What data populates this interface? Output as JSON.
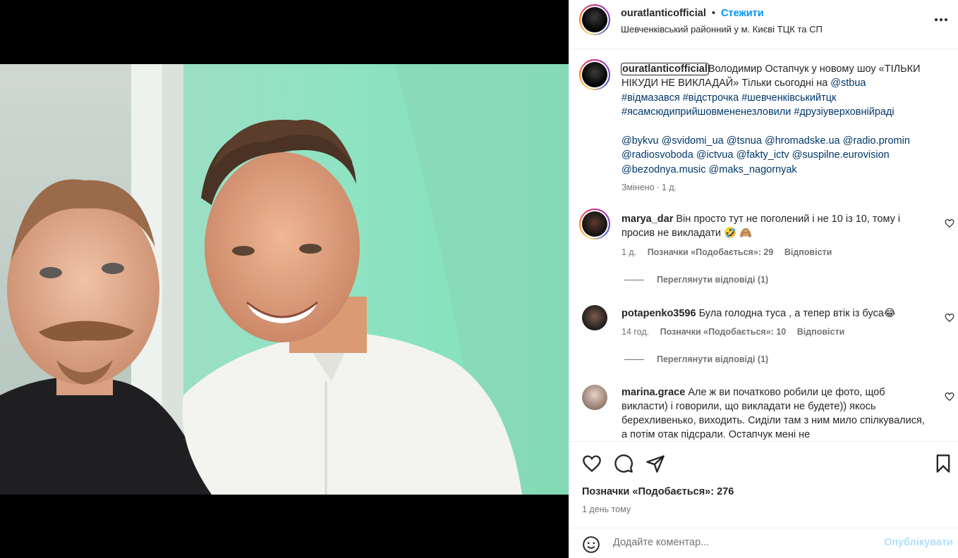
{
  "post": {
    "username": "ouratlanticofficial",
    "dot": "•",
    "follow_label": "Стежити",
    "location": "Шевченківський районний у м. Києві ТЦК та СП",
    "more_icon": "more-horizontal-icon"
  },
  "caption": {
    "username": "ouratlanticofficial",
    "text_lead": "Володимир Остапчук у новому шоу «ТІЛЬКИ НІКУДИ НЕ ВИКЛАДАЙ» Тільки сьогодні на ",
    "stb": "@stbua",
    "hashtags": [
      "#відмазався",
      "#відстрочка",
      "#шевченківськийтцк",
      "#ясамсюдиприйшовмененезловили",
      "#друзіуверховнійраді"
    ],
    "mentions": [
      "@bykvu",
      "@svidomi_ua",
      "@tsnua",
      "@hromadske.ua",
      "@radio.promin",
      "@radiosvoboda",
      "@ictvua",
      "@fakty_ictv",
      "@suspilne.eurovision",
      "@bezodnya.music",
      "@maks_nagornyak"
    ],
    "edited": "Змінено",
    "dot": "·",
    "time": "1 д."
  },
  "comments": [
    {
      "username": "marya_dar",
      "text": "Він просто тут не поголений і не 10 із 10, тому і просив не викладати 🤣 🙈",
      "time": "1 д.",
      "likes": "Позначки «Подобається»: 29",
      "reply": "Відповісти",
      "view_replies": "Переглянути відповіді (1)"
    },
    {
      "username": "potapenko3596",
      "text": "Була голодна туса , а тепер втік із буса😂",
      "time": "14 год.",
      "likes": "Позначки «Подобається»: 10",
      "reply": "Відповісти",
      "view_replies": "Переглянути відповіді (1)"
    },
    {
      "username": "marina.grace",
      "text": "Але ж ви початково робили це фото, щоб викласти) і говорили, що викладати не будете)) якось берехливенько, виходить. Сиділи там з ним мило спілкувалися, а потім отак підсрали. Остапчук мені не"
    }
  ],
  "footer": {
    "likes": "Позначки «Подобається»: 276",
    "ago": "1 день тому",
    "comment_placeholder": "Додайте коментар...",
    "post_label": "Опублікувати"
  },
  "colors": {
    "accent": "#0095f6",
    "link": "#00376b",
    "muted": "#737373"
  }
}
